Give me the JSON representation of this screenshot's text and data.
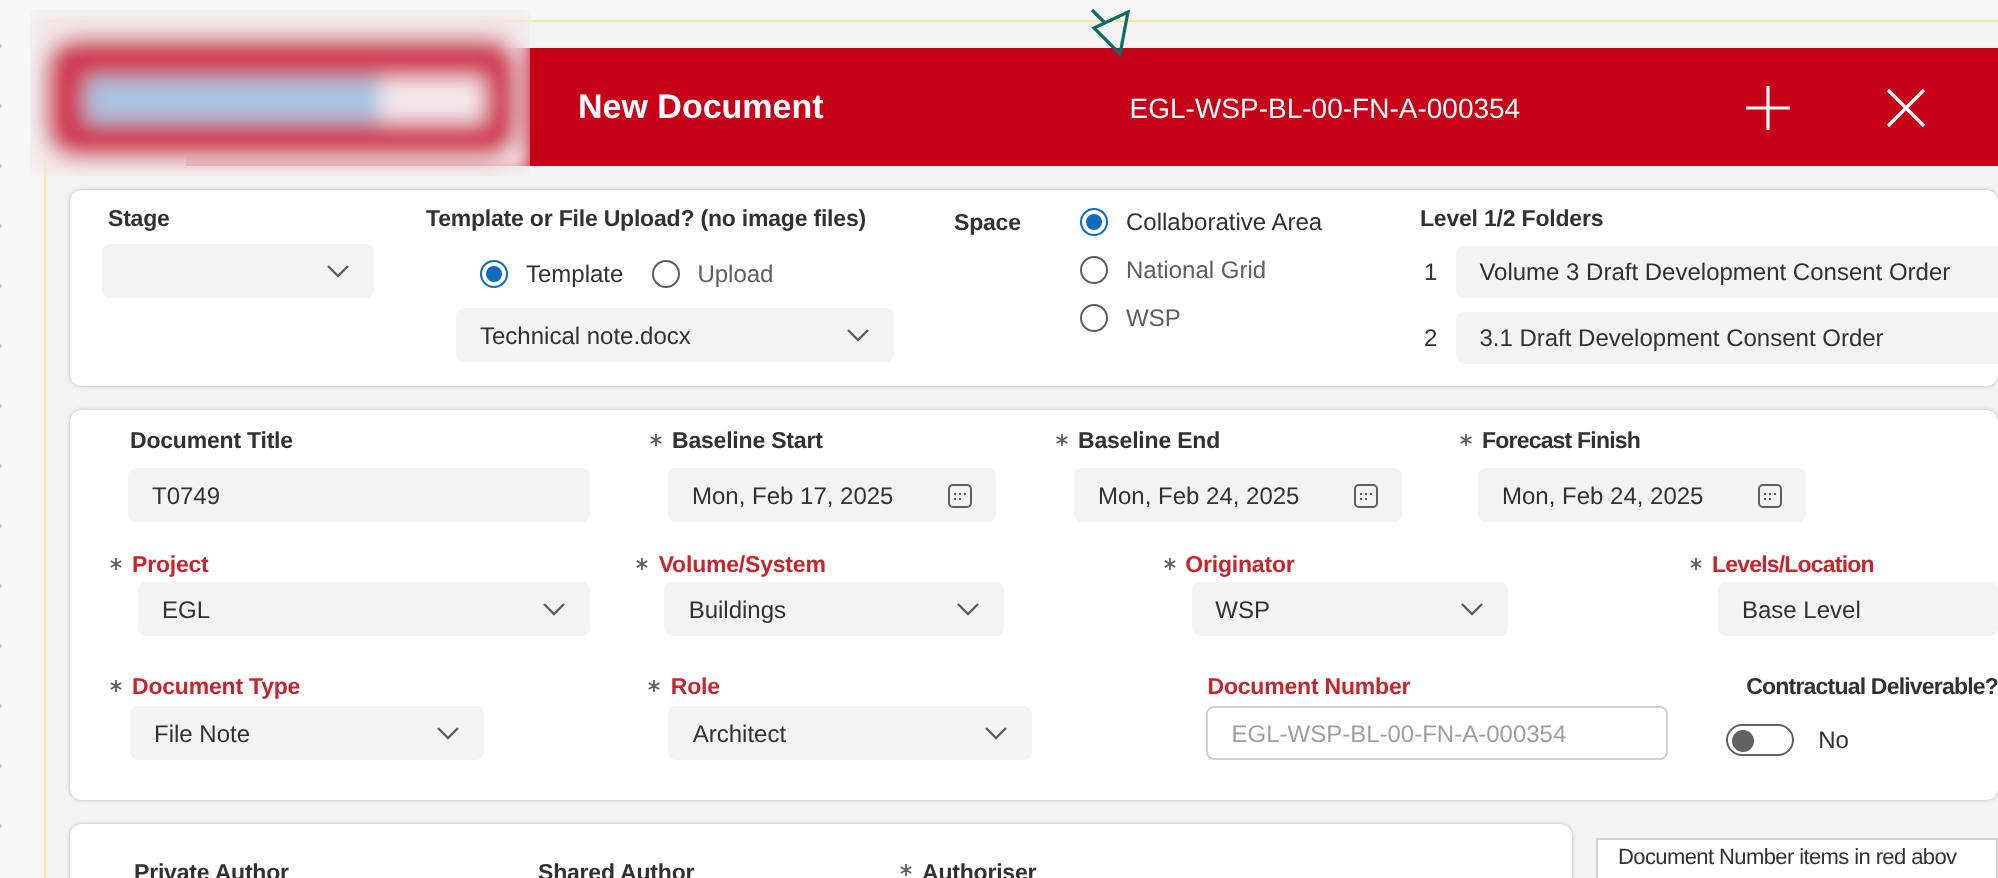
{
  "header": {
    "title": "New Document",
    "document_number": "EGL-WSP-BL-00-FN-A-000354"
  },
  "setup": {
    "stage": {
      "label": "Stage"
    },
    "template_upload": {
      "label": "Template or File Upload? (no image files)",
      "options": [
        {
          "label": "Template",
          "selected": true
        },
        {
          "label": "Upload",
          "selected": false
        }
      ],
      "file": "Technical note.docx"
    },
    "space": {
      "label": "Space",
      "options": [
        {
          "label": "Collaborative Area",
          "selected": true
        },
        {
          "label": "National Grid",
          "selected": false
        },
        {
          "label": "WSP",
          "selected": false
        }
      ]
    },
    "folders": {
      "label": "Level 1/2 Folders",
      "items": [
        {
          "number": "1",
          "value": "Volume 3 Draft Development Consent Order"
        },
        {
          "number": "2",
          "value": "3.1 Draft Development Consent Order"
        }
      ]
    }
  },
  "details": {
    "rows": [
      [
        {
          "kind": "text",
          "label": "Document Title",
          "required": false,
          "highlighted": false,
          "value": "T0749"
        },
        {
          "kind": "date",
          "label": "Baseline Start",
          "required": true,
          "highlighted": false,
          "value": "Mon, Feb 17, 2025"
        },
        {
          "kind": "date",
          "label": "Baseline End",
          "required": true,
          "highlighted": false,
          "value": "Mon, Feb 24, 2025"
        },
        {
          "kind": "date",
          "label": "Forecast Finish",
          "required": true,
          "highlighted": false,
          "value": "Mon, Feb 24, 2025"
        }
      ],
      [
        {
          "kind": "dropdown",
          "label": "Project",
          "required": true,
          "highlighted": true,
          "value": "EGL"
        },
        {
          "kind": "dropdown",
          "label": "Volume/System",
          "required": true,
          "highlighted": true,
          "value": "Buildings"
        },
        {
          "kind": "dropdown",
          "label": "Originator",
          "required": true,
          "highlighted": true,
          "value": "WSP"
        },
        {
          "kind": "text",
          "label": "Levels/Location",
          "required": true,
          "highlighted": true,
          "value": "Base Level"
        }
      ],
      [
        {
          "kind": "dropdown",
          "label": "Document Type",
          "required": true,
          "highlighted": true,
          "value": "File Note"
        },
        {
          "kind": "dropdown",
          "label": "Role",
          "required": true,
          "highlighted": true,
          "value": "Architect"
        },
        {
          "kind": "readonly",
          "label": "Document Number",
          "required": false,
          "highlighted": true,
          "placeholder": "EGL-WSP-BL-00-FN-A-000354"
        },
        {
          "kind": "toggle",
          "label": "Contractual Deliverable?",
          "required": false,
          "highlighted": false,
          "on": false,
          "value": "No"
        }
      ]
    ]
  },
  "people": {
    "fields": [
      {
        "label": "Private Author",
        "required": false
      },
      {
        "label": "Shared Author",
        "required": false
      },
      {
        "label": "Authoriser",
        "required": true
      }
    ],
    "note": "Document Number items in red abov"
  }
}
